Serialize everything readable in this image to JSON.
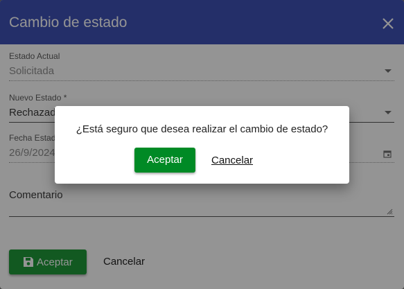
{
  "dialog": {
    "title": "Cambio de estado"
  },
  "form": {
    "current_state": {
      "label": "Estado Actual",
      "value": "Solicitada"
    },
    "new_state": {
      "label": "Nuevo Estado *",
      "value": "Rechazada"
    },
    "state_date": {
      "label": "Fecha Estado",
      "value": "26/9/2024"
    },
    "comment": {
      "label": "Comentario"
    }
  },
  "actions": {
    "accept_label": "Aceptar",
    "cancel_label": "Cancelar"
  },
  "confirm": {
    "message": "¿Está seguro que desea realizar el cambio de estado?",
    "accept_label": "Aceptar",
    "cancel_label": "Cancelar"
  },
  "icons": {
    "close": "close-icon",
    "dropdown": "chevron-down-icon",
    "calendar": "calendar-icon",
    "save": "save-icon",
    "resize": "resize-handle-icon"
  },
  "colors": {
    "header": "#3f51b5",
    "accept_button": "#1f9a3a",
    "confirm_accept_button": "#008a25"
  }
}
